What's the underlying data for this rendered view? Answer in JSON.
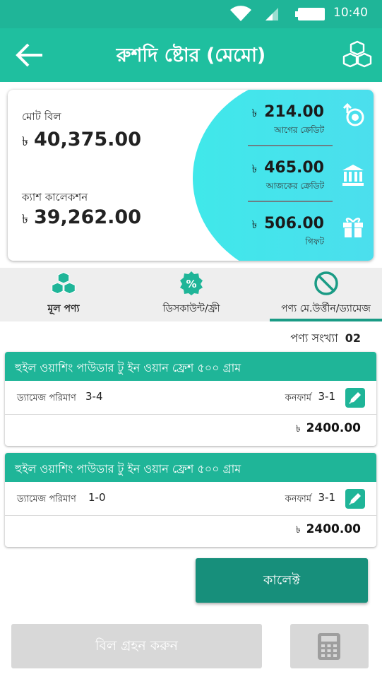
{
  "status_bar": {
    "time": "10:40"
  },
  "app_bar": {
    "title": "রুশদি ষ্টোর (মেমো)"
  },
  "summary": {
    "currency": "৳",
    "total_bill_label": "মোট বিল",
    "total_bill": "40,375.00",
    "cash_collection_label": "ক্যাশ কালেকশন",
    "cash_collection": "39,262.00",
    "credits": [
      {
        "value": "214.00",
        "label": "আগের ক্রেডিট",
        "icon": "previous-credit-icon"
      },
      {
        "value": "465.00",
        "label": "আজকের ক্রেডিট",
        "icon": "bank-icon"
      },
      {
        "value": "506.00",
        "label": "গিফট",
        "icon": "gift-icon"
      }
    ]
  },
  "tabs": [
    {
      "label": "মূল পণ্য",
      "icon": "boxes-icon"
    },
    {
      "label": "ডিসকাউন্ট/ফ্রী",
      "icon": "discount-icon"
    },
    {
      "label": "পণ্য মে.উর্ত্তীন/ড্যামেজ",
      "icon": "block-icon",
      "active": true
    }
  ],
  "product_count": {
    "label": "পণ্য সংখ্যা",
    "value": "02"
  },
  "items": [
    {
      "name": "হুইল ওয়াশিং পাউডার টু ইন ওয়ান ফ্রেশ ৫০০ গ্রাম",
      "damage_label": "ড্যামেজ পরিমাণ",
      "damage_value": "3-4",
      "confirm_label": "কনফার্ম",
      "confirm_value": "3-1",
      "currency": "৳",
      "total": "2400.00"
    },
    {
      "name": "হুইল ওয়াশিং পাউডার টু ইন ওয়ান ফ্রেশ ৫০০ গ্রাম",
      "damage_label": "ড্যামেজ পরিমাণ",
      "damage_value": "1-0",
      "confirm_label": "কনফার্ম",
      "confirm_value": "3-1",
      "currency": "৳",
      "total": "2400.00"
    }
  ],
  "buttons": {
    "collect": "কালেক্ট",
    "receive_bill": "বিল গ্রহন করুন"
  },
  "colors": {
    "primary": "#1fb598",
    "primary_dark": "#178f7b",
    "accent_gradient": "#40e8ea",
    "disabled": "#d8d8d8"
  }
}
